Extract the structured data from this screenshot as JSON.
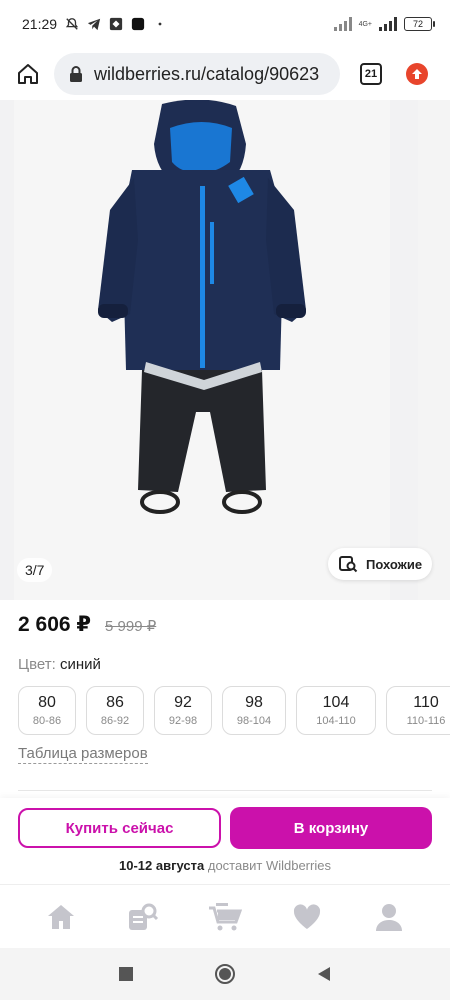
{
  "status_bar": {
    "time": "21:29",
    "network_label": "4G+",
    "battery": "72"
  },
  "browser": {
    "url": "wildberries.ru/catalog/90623",
    "tab_count": "21"
  },
  "gallery": {
    "counter": "3/7",
    "similar_label": "Похожие"
  },
  "product": {
    "price": "2 606 ₽",
    "old_price": "5 999 ₽",
    "color_label": "Цвет:",
    "color_value": "синий",
    "sizes": [
      {
        "main": "80",
        "sub": "80-86"
      },
      {
        "main": "86",
        "sub": "86-92"
      },
      {
        "main": "92",
        "sub": "92-98"
      },
      {
        "main": "98",
        "sub": "98-104"
      },
      {
        "main": "104",
        "sub": "104-110"
      },
      {
        "main": "110",
        "sub": "110-116"
      }
    ],
    "size_table_label": "Таблица размеров"
  },
  "actions": {
    "buy_now": "Купить сейчас",
    "add_to_cart": "В корзину",
    "delivery_date": "10-12 августа",
    "delivery_text": " доставит Wildberries"
  },
  "colors": {
    "brand": "#cb11ab",
    "nav_icon": "#c5c5cc"
  },
  "icons": {
    "home": "home-icon",
    "lock": "lock-icon",
    "tabs": "tabs-icon",
    "update": "update-icon",
    "similar": "search-similar-icon",
    "nav": [
      "home-icon",
      "catalog-search-icon",
      "cart-icon",
      "heart-icon",
      "profile-icon"
    ]
  }
}
